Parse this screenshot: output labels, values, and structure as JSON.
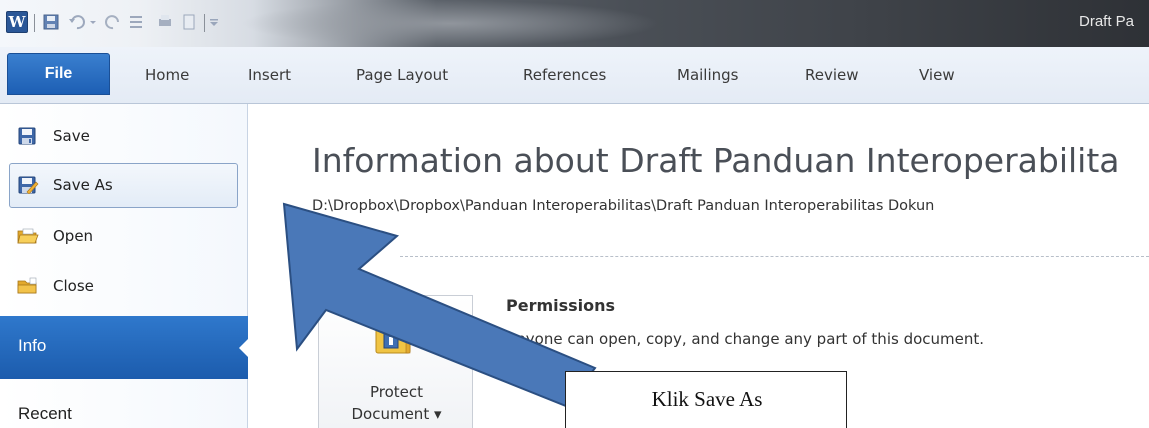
{
  "window": {
    "app_icon_letter": "W",
    "doc_title": "Draft Pa"
  },
  "ribbon": {
    "tabs": [
      "File",
      "Home",
      "Insert",
      "Page Layout",
      "References",
      "Mailings",
      "Review",
      "View"
    ]
  },
  "backstage": {
    "items": [
      {
        "label": "Save",
        "icon": "save-icon"
      },
      {
        "label": "Save As",
        "icon": "save-as-icon"
      },
      {
        "label": "Open",
        "icon": "open-folder-icon"
      },
      {
        "label": "Close",
        "icon": "close-folder-icon"
      }
    ],
    "info_label": "Info",
    "recent_label": "Recent"
  },
  "main": {
    "title": "Information about Draft Panduan Interoperabilita",
    "path": "D:\\Dropbox\\Dropbox\\Panduan Interoperabilitas\\Draft Panduan Interoperabilitas Dokun",
    "protect_button": {
      "line1": "Protect",
      "line2": "Document ▾"
    },
    "permissions_title": "Permissions",
    "permissions_desc": "Anyone can open, copy, and change any part of this document."
  },
  "annotation": {
    "callout_text": "Klik Save As",
    "arrow_color": "#4a78b8"
  },
  "colors": {
    "file_tab": "#2a6fc4",
    "info_selected": "#2a6fc4"
  }
}
